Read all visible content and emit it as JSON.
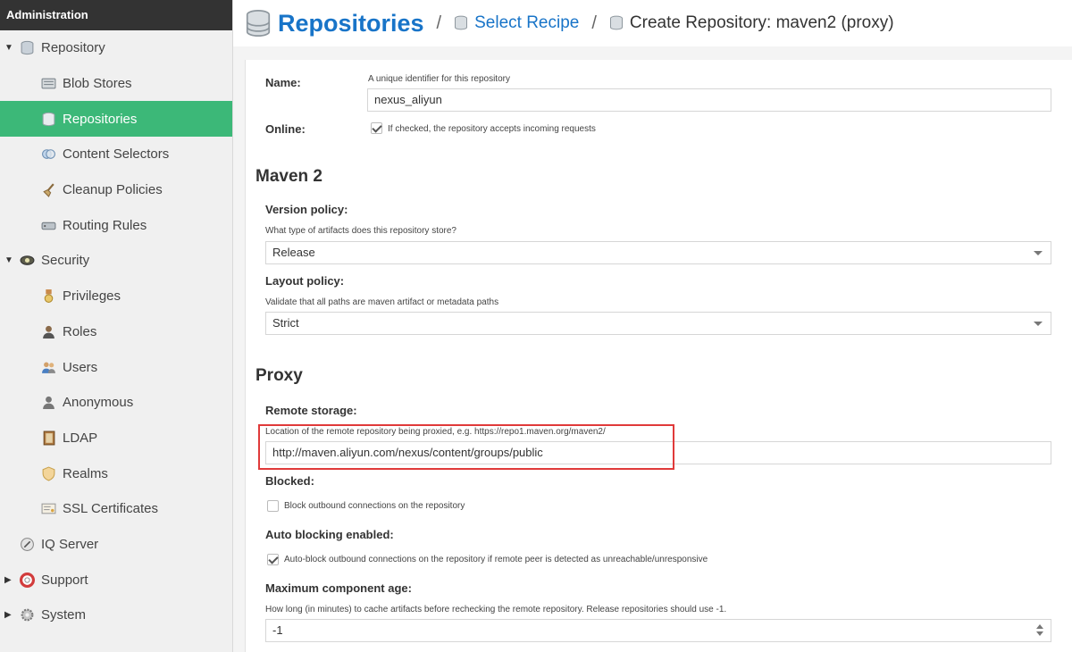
{
  "sidebar": {
    "header": "Administration",
    "items": [
      {
        "label": "Repository",
        "toggle": "▼"
      },
      {
        "label": "Blob Stores"
      },
      {
        "label": "Repositories"
      },
      {
        "label": "Content Selectors"
      },
      {
        "label": "Cleanup Policies"
      },
      {
        "label": "Routing Rules"
      },
      {
        "label": "Security",
        "toggle": "▼"
      },
      {
        "label": "Privileges"
      },
      {
        "label": "Roles"
      },
      {
        "label": "Users"
      },
      {
        "label": "Anonymous"
      },
      {
        "label": "LDAP"
      },
      {
        "label": "Realms"
      },
      {
        "label": "SSL Certificates"
      },
      {
        "label": "IQ Server"
      },
      {
        "label": "Support",
        "toggle": "▶"
      },
      {
        "label": "System",
        "toggle": "▶"
      }
    ]
  },
  "header": {
    "title": "Repositories",
    "sep": "/",
    "crumb1": "Select Recipe",
    "crumb2": "Create Repository: maven2 (proxy)"
  },
  "form": {
    "name_label": "Name:",
    "name_help": "A unique identifier for this repository",
    "name_value": "nexus_aliyun",
    "online_label": "Online:",
    "online_help": "If checked, the repository accepts incoming requests",
    "maven_section": "Maven 2",
    "version_label": "Version policy:",
    "version_help": "What type of artifacts does this repository store?",
    "version_value": "Release",
    "layout_label": "Layout policy:",
    "layout_help": "Validate that all paths are maven artifact or metadata paths",
    "layout_value": "Strict",
    "proxy_section": "Proxy",
    "remote_label": "Remote storage:",
    "remote_help": "Location of the remote repository being proxied, e.g. https://repo1.maven.org/maven2/",
    "remote_value": "http://maven.aliyun.com/nexus/content/groups/public",
    "blocked_label": "Blocked:",
    "blocked_help": "Block outbound connections on the repository",
    "auto_label": "Auto blocking enabled:",
    "auto_help": "Auto-block outbound connections on the repository if remote peer is detected as unreachable/unresponsive",
    "max_label": "Maximum component age:",
    "max_help": "How long (in minutes) to cache artifacts before rechecking the remote repository. Release repositories should use -1.",
    "max_value": "-1"
  },
  "colors": {
    "accent": "#1874c8",
    "active": "#3cb878",
    "highlight": "#e03a3a"
  }
}
